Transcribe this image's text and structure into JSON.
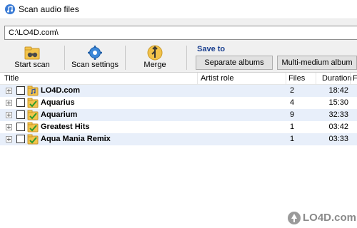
{
  "window": {
    "title": "Scan audio files"
  },
  "path": {
    "value": "C:\\LO4D.com\\"
  },
  "toolbar": {
    "start_scan": "Start scan",
    "scan_settings": "Scan settings",
    "merge": "Merge",
    "save_to": "Save to",
    "separate_albums": "Separate albums",
    "multi_medium_album": "Multi-medium album"
  },
  "columns": {
    "title": "Title",
    "artist_role": "Artist role",
    "files": "Files",
    "duration": "Duration",
    "extra": "F"
  },
  "rows": [
    {
      "title": "LO4D.com",
      "files": "2",
      "duration": "18:42"
    },
    {
      "title": "Aquarius",
      "files": "4",
      "duration": "15:30"
    },
    {
      "title": "Aquarium",
      "files": "9",
      "duration": "32:33"
    },
    {
      "title": "Greatest Hits",
      "files": "1",
      "duration": "03:42"
    },
    {
      "title": "Aqua Mania Remix",
      "files": "1",
      "duration": "03:33"
    }
  ],
  "watermark": {
    "text": "LO4D.com"
  },
  "colors": {
    "row_alt": "#e8effa",
    "save_to": "#1a3f8f",
    "toolbar_bg": "#f0f0f0"
  }
}
